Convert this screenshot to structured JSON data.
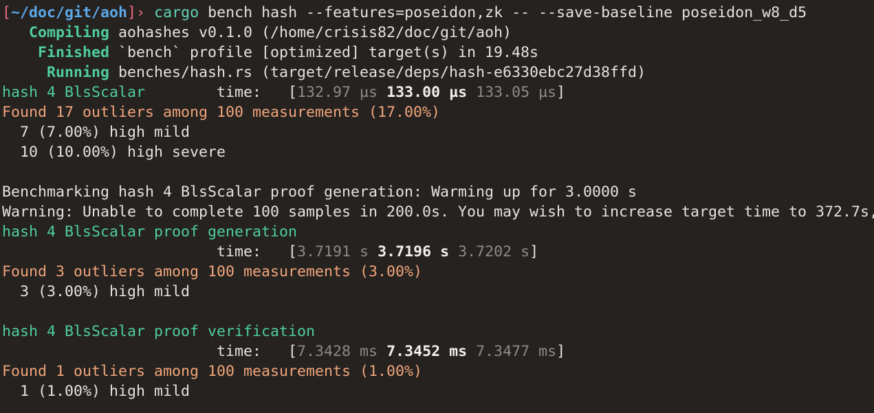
{
  "prompt": {
    "open_bracket": "[",
    "path": "~/doc/git/aoh",
    "close_bracket": "]",
    "symbol": "›",
    "command": "cargo",
    "args": "bench hash --features=poseidon,zk -- --save-baseline poseidon_w8_d5"
  },
  "build": {
    "compiling_pad": "   ",
    "compiling_label": "Compiling",
    "compiling_text": " aohashes v0.1.0 (/home/crisis82/doc/git/aoh)",
    "finished_pad": "    ",
    "finished_label": "Finished",
    "finished_text": " `bench` profile [optimized] target(s) in 19.48s",
    "running_pad": "     ",
    "running_label": "Running",
    "running_text": " benches/hash.rs (target/release/deps/hash-e6330ebc27d38ffd)"
  },
  "bench1": {
    "name": "hash 4 BlsScalar",
    "time_label": "        time:   ",
    "open": "[",
    "low": "132.97 µs",
    "mid": "133.00 µs",
    "high": "133.05 µs",
    "close": "]",
    "outliers": "Found 17 outliers among 100 measurements (17.00%)",
    "detail1": "  7 (7.00%) high mild",
    "detail2": "  10 (10.00%) high severe"
  },
  "bench2": {
    "warmup": "Benchmarking hash 4 BlsScalar proof generation: Warming up for 3.0000 s",
    "warning": "Warning: Unable to complete 100 samples in 200.0s. You may wish to increase target time to 372.7s,",
    "name": "hash 4 BlsScalar proof generation",
    "time_label": "                        time:   ",
    "open": "[",
    "low": "3.7191 s",
    "mid": "3.7196 s",
    "high": "3.7202 s",
    "close": "]",
    "outliers": "Found 3 outliers among 100 measurements (3.00%)",
    "detail1": "  3 (3.00%) high mild"
  },
  "bench3": {
    "name": "hash 4 BlsScalar proof verification",
    "time_label": "                        time:   ",
    "open": "[",
    "low": "7.3428 ms",
    "mid": "7.3452 ms",
    "high": "7.3477 ms",
    "close": "]",
    "outliers": "Found 1 outliers among 100 measurements (1.00%)",
    "detail1": "  1 (1.00%) high mild"
  },
  "colors": {
    "background": "#252220",
    "prompt_accent": "#f06b80",
    "path": "#5da8e8",
    "command": "#62d4b8",
    "bench_name": "#4fcd9e",
    "outliers": "#f1a57a",
    "dim": "#908a85",
    "text": "#e8e2dc"
  }
}
